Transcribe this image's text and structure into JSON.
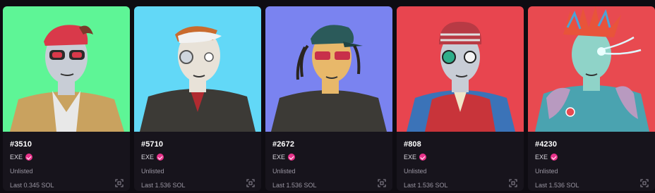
{
  "cards": [
    {
      "token": "#3510",
      "collection": "EXE",
      "status": "Unlisted",
      "last_price": "Last 0.345 SOL",
      "bg": "#5ef596",
      "skin": "#c8cdd6",
      "hair": "#7a3a2a",
      "accent": "#d9394a",
      "jacket": "#c9a25f"
    },
    {
      "token": "#5710",
      "collection": "EXE",
      "status": "Unlisted",
      "last_price": "Last 1.536 SOL",
      "bg": "#62d8f7",
      "skin": "#e8e2d8",
      "hair": "#c96b2e",
      "accent": "#f2f2f2",
      "jacket": "#3c3a36"
    },
    {
      "token": "#2672",
      "collection": "EXE",
      "status": "Unlisted",
      "last_price": "Last 1.536 SOL",
      "bg": "#7a83f0",
      "skin": "#e8b86a",
      "hair": "#2a2520",
      "accent": "#2b5a5a",
      "jacket": "#3c3a36"
    },
    {
      "token": "#808",
      "collection": "EXE",
      "status": "Unlisted",
      "last_price": "Last 1.536 SOL",
      "bg": "#e8454f",
      "skin": "#c8cdd6",
      "hair": "#3a3a3a",
      "accent": "#3b73b8",
      "jacket": "#c8343a"
    },
    {
      "token": "#4230",
      "collection": "EXE",
      "status": "Unlisted",
      "last_price": "Last 1.536 SOL",
      "bg": "#e84a50",
      "skin": "#8fd3c8",
      "hair": "#e8543a",
      "accent": "#5ec8d8",
      "jacket": "#4aa3b0"
    }
  ]
}
